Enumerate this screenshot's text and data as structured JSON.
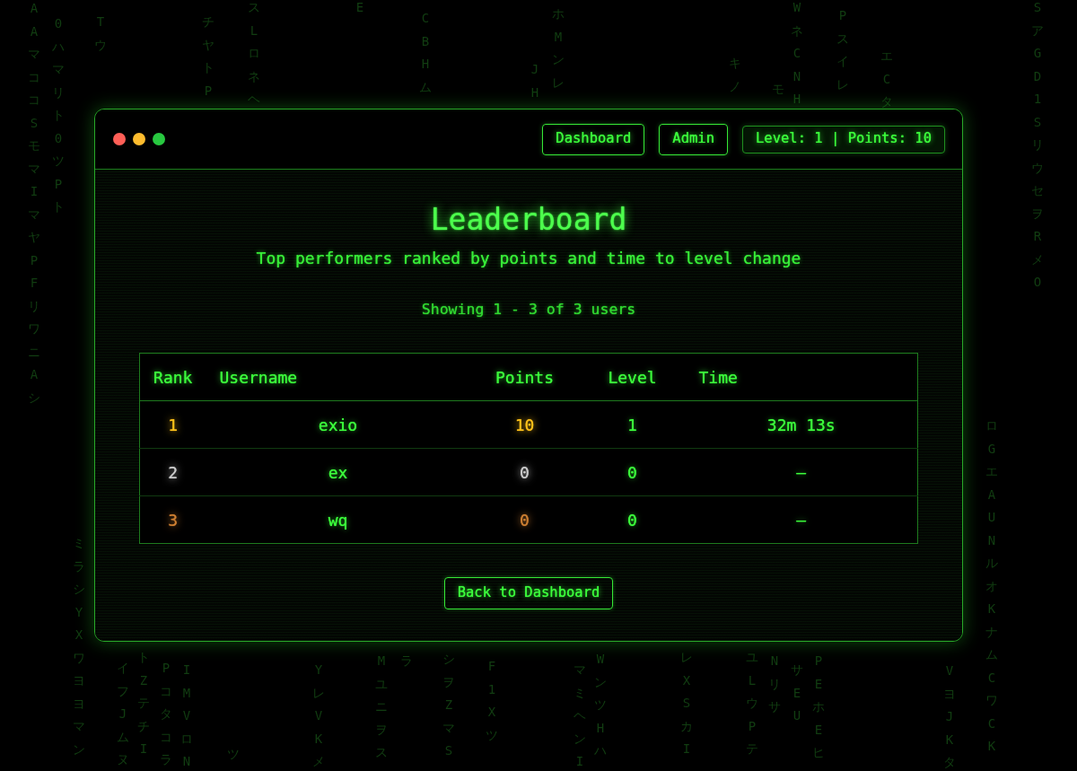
{
  "header": {
    "nav": [
      {
        "label": "Dashboard"
      },
      {
        "label": "Admin"
      }
    ],
    "status": "Level: 1 | Points: 10"
  },
  "page": {
    "title": "Leaderboard",
    "subtitle": "Top performers ranked by points and time to level change",
    "summary": "Showing 1 - 3 of 3 users"
  },
  "table": {
    "columns": [
      "Rank",
      "Username",
      "Points",
      "Level",
      "Time"
    ],
    "rows": [
      {
        "rank": "1",
        "username": "exio",
        "points": "10",
        "level": "1",
        "time": "32m 13s",
        "color": "#ffc21a"
      },
      {
        "rank": "2",
        "username": "ex",
        "points": "0",
        "level": "0",
        "time": "–",
        "color": "#cccccc"
      },
      {
        "rank": "3",
        "username": "wq",
        "points": "0",
        "level": "0",
        "time": "–",
        "color": "#cd7f32"
      }
    ]
  },
  "back_button": {
    "label": "Back to Dashboard"
  },
  "background_rain": [
    {
      "text": "AAマココSモマIマヤPFリワニAシ"
    },
    {
      "text": "0ハマリト0ツPト"
    },
    {
      "text": "Tウ"
    },
    {
      "text": "チヤトP"
    },
    {
      "text": "スLロネヘ"
    },
    {
      "text": "E"
    },
    {
      "text": "CBHム"
    },
    {
      "text": "JH"
    },
    {
      "text": "ホMンレ"
    },
    {
      "text": "キノ"
    },
    {
      "text": "モ"
    },
    {
      "text": "WネCNH"
    },
    {
      "text": "Pスイレ"
    },
    {
      "text": "エCタ"
    },
    {
      "text": "SアGD1SリウセヲRメO"
    },
    {
      "text": "ミラシYXワヨヨマン"
    },
    {
      "text": "イフJムヌ"
    },
    {
      "text": "トZテチI"
    },
    {
      "text": "Pコタコラ"
    },
    {
      "text": "IMVロN"
    },
    {
      "text": "ツ"
    },
    {
      "text": "YレVKメ"
    },
    {
      "text": "Mユニヲス"
    },
    {
      "text": "ラ"
    },
    {
      "text": "シヲZマS"
    },
    {
      "text": "F1Xツ"
    },
    {
      "text": "マミヘンI"
    },
    {
      "text": "WンツHハ"
    },
    {
      "text": "レXSカI"
    },
    {
      "text": "ユLウPテ"
    },
    {
      "text": "Nリサ"
    },
    {
      "text": "サEU"
    },
    {
      "text": "PEホEヒ"
    },
    {
      "text": "VヨJKタ"
    },
    {
      "text": "ロGエAUNルオKナムCワCK"
    }
  ]
}
